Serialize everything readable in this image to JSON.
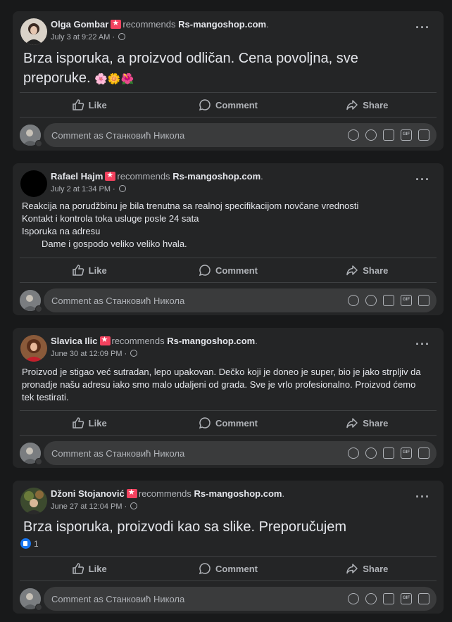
{
  "comment_placeholder": "Comment as Станковић Никола",
  "actions": {
    "like": "Like",
    "comment": "Comment",
    "share": "Share"
  },
  "recommends_text": "recommends",
  "page_name": "Rs-mangoshop.com",
  "colors": {
    "background": "#18191a",
    "card": "#242526",
    "input": "#3a3b3c",
    "muted": "#b0b3b8",
    "badge": "#f3425f",
    "like_blue": "#1877f2"
  },
  "comment_icons": [
    "avatar-sticker-icon",
    "emoji-icon",
    "camera-icon",
    "gif-icon",
    "sticker-icon"
  ],
  "posts": [
    {
      "author": "Olga Gombar",
      "date": "July 3 at 9:22 AM",
      "text_lines": [
        "Brza isporuka, a proizvod odličan. Cena povoljna, sve",
        "preporuke. "
      ],
      "emojis": "🌸🌼🌺"
    },
    {
      "author": "Rafael Hajm",
      "date": "July 2 at 1:34 PM",
      "text_lines": [
        "Reakcija na porudžbinu je bila trenutna sa realnoj specifikacijom novčane vrednosti",
        "Kontakt i kontrola toka usluge posle 24 sata",
        "Isporuka na adresu",
        "Dame i gospodo veliko veliko hvala."
      ]
    },
    {
      "author": "Slavica Ilic",
      "date": "June 30 at 12:09 PM",
      "text_lines": [
        "Proizvod je stigao već sutradan, lepo upakovan. Dečko koji je doneo je super, bio je jako strpljiv da",
        "pronadje našu adresu iako smo malo udaljeni od grada. Sve je vrlo profesionalno. Proizvod ćemo",
        "tek testirati."
      ]
    },
    {
      "author": "Džoni Stojanović",
      "date": "June 27 at 12:04 PM",
      "text_lines": [
        "Brza isporuka, proizvodi kao sa slike. Preporučujem"
      ],
      "reaction_count": "1"
    }
  ]
}
